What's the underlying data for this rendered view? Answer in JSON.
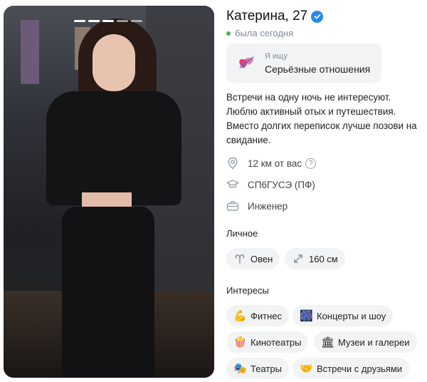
{
  "photo": {
    "alt_icon": "photo-person",
    "slides_count": 5,
    "active_slide": 0
  },
  "profile": {
    "name": "Катерина, 27",
    "verified_icon": "verified-check-icon",
    "status": "была сегодня",
    "status_color": "#4bb34b"
  },
  "seeking": {
    "label": "Я ищу",
    "value": "Серьёзные отношения",
    "icon": "hearts-icon"
  },
  "bio": {
    "line1": "Встречи на одну ночь не интересуют.",
    "line2": "Люблю активный отых и путешествия.",
    "line3": "Вместо долгих переписок лучше позови на",
    "line4": "свидание."
  },
  "details": {
    "distance": "12 км от вас",
    "distance_help": "?",
    "education": "СП6ГУСЭ (ПФ)",
    "job": "Инженер"
  },
  "personal": {
    "title": "Личное",
    "zodiac": "Овен",
    "height": "160 см"
  },
  "interests": {
    "title": "Интересы",
    "items": [
      {
        "label": "Фитнес",
        "icon": "💪"
      },
      {
        "label": "Концерты и шоу",
        "icon": "🎆"
      },
      {
        "label": "Кинотеатры",
        "icon": "🍿"
      },
      {
        "label": "Музеи и галереи",
        "icon": "🏛"
      },
      {
        "label": "Театры",
        "icon": "🎭"
      },
      {
        "label": "Встречи с друзьями",
        "icon": "🤝"
      }
    ]
  },
  "colors": {
    "accent": "#2688eb",
    "chip_bg": "#f2f3f5",
    "secondary_text": "#818c99"
  }
}
